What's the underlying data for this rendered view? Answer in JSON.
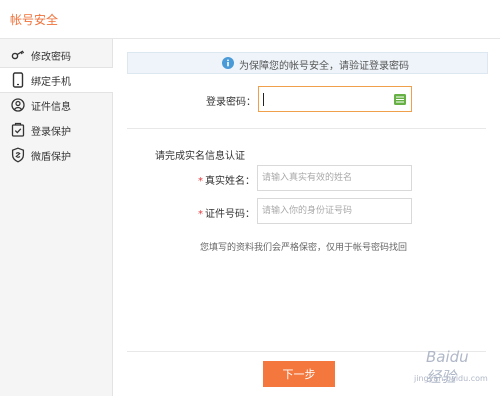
{
  "header": {
    "title": "帐号安全"
  },
  "sidebar": {
    "items": [
      {
        "label": "修改密码",
        "icon": "key-icon"
      },
      {
        "label": "绑定手机",
        "icon": "phone-icon"
      },
      {
        "label": "证件信息",
        "icon": "user-icon"
      },
      {
        "label": "登录保护",
        "icon": "lock-shield-icon"
      },
      {
        "label": "微盾保护",
        "icon": "shield-icon"
      }
    ],
    "active_index": 1
  },
  "notice": {
    "text": "为保障您的帐号安全，请验证登录密码"
  },
  "form": {
    "password_label": "登录密码：",
    "section_title": "请完成实名信息认证",
    "realname_label": "真实姓名：",
    "realname_placeholder": "请输入真实有效的姓名",
    "idnum_label": "证件号码：",
    "idnum_placeholder": "请输入你的身份证号码",
    "required_mark": "*",
    "privacy_tip": "您填写的资料我们会严格保密，仅用于帐号密码找回"
  },
  "actions": {
    "next_label": "下一步"
  },
  "watermark": {
    "brand": "Baidu 经验",
    "url": "jingyan.baidu.com"
  },
  "colors": {
    "accent": "#f4773d",
    "notice_bg": "#eef4f9",
    "active_border": "#f0a04b"
  }
}
